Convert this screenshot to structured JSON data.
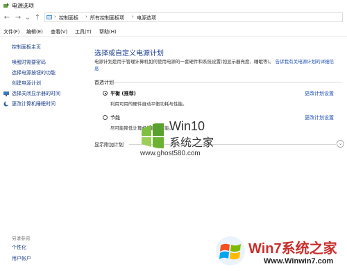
{
  "window": {
    "title": "电源选项"
  },
  "address": {
    "crumbs": [
      "控制面板",
      "所有控制面板项",
      "电源选项"
    ],
    "sep": "›"
  },
  "nav": {
    "back": "←",
    "forward": "→",
    "recent": "⌄",
    "up": "↑"
  },
  "menu": {
    "items": [
      "文件(F)",
      "编辑(E)",
      "查看(V)",
      "工具(T)",
      "帮助(H)"
    ]
  },
  "sidebar": {
    "home": "控制面板主页",
    "items": [
      "唤醒时需要密码",
      "选择电源按钮的功能",
      "创建电源计划",
      "选择关闭显示器的时间",
      "更改计算机睡眠时间"
    ],
    "see_also_label": "另请参阅",
    "see_also_items": [
      "个性化",
      "用户帐户"
    ]
  },
  "main": {
    "heading": "选择或自定义电源计划",
    "description": "电源计划是用于管理计算机如何使用电源的一套硬件和系统设置(如显示器亮度、睡眠等)。",
    "description_link": "告诉我有关电源计划的详细信息",
    "preferred_label": "首选计划",
    "plans": [
      {
        "name": "平衡 (推荐)",
        "desc": "利用可用的硬件自动平衡功耗与性能。",
        "selected": true,
        "change_link": "更改计划设置"
      },
      {
        "name": "节能",
        "desc": "尽可能降低计算机性能以节能。",
        "selected": false,
        "change_link": "更改计划设置"
      }
    ],
    "additional_label": "显示附加计划",
    "expand_icon": "⌄"
  },
  "watermarks": {
    "top": {
      "line1": "Win10",
      "line2": "系统之家",
      "line3": "www.ghost580.com"
    },
    "bottom": {
      "line1": "Win7系统之家",
      "line2": "Www.Winwin7.com"
    }
  },
  "colors": {
    "heading": "#1c3f94",
    "link": "#1d4fb3",
    "accent_red": "#c9302c"
  }
}
